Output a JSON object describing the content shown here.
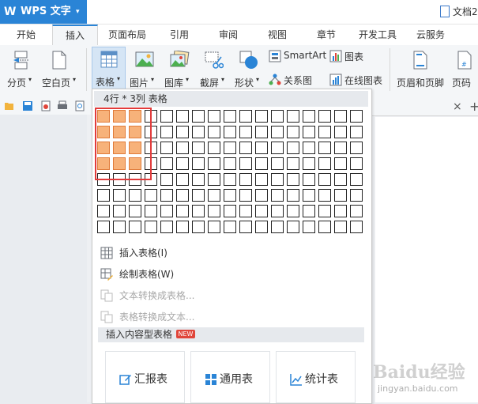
{
  "titlebar": {
    "app_logo": "W",
    "app_name": "WPS 文字",
    "dropdown_arrow": "▾",
    "doc_title": "文档2"
  },
  "menu": {
    "tabs": [
      "开始",
      "插入",
      "页面布局",
      "引用",
      "审阅",
      "视图",
      "章节",
      "开发工具",
      "云服务"
    ],
    "active": "插入"
  },
  "ribbon": {
    "page_break": "分页",
    "blank_page": "空白页",
    "table": "表格",
    "picture": "图片",
    "gallery": "图库",
    "screenshot": "截屏",
    "shape": "形状",
    "smartart": "SmartArt",
    "chart": "图表",
    "relation": "关系图",
    "online_chart": "在线图表",
    "header_footer": "页眉和页脚",
    "page_number": "页码",
    "arrow": "▾"
  },
  "doc_tab": {
    "close": "×",
    "add": "+"
  },
  "dropdown": {
    "header": "4行 * 3列 表格",
    "grid": {
      "rows": 8,
      "cols": 17,
      "selected_rows": 4,
      "selected_cols": 3
    },
    "items": [
      {
        "label": "插入表格(I)",
        "enabled": true,
        "icon": "insert-table-icon"
      },
      {
        "label": "绘制表格(W)",
        "enabled": true,
        "icon": "draw-table-icon"
      },
      {
        "label": "文本转换成表格...",
        "enabled": false,
        "icon": "text-to-table-icon"
      },
      {
        "label": "表格转换成文本...",
        "enabled": false,
        "icon": "table-to-text-icon"
      }
    ],
    "section": "插入内容型表格",
    "new_badge": "NEW",
    "cards": [
      "汇报表",
      "通用表",
      "统计表"
    ]
  },
  "watermark": {
    "text": "Baidu经验",
    "url": "jingyan.baidu.com"
  },
  "colors": {
    "accent": "#2a84d6",
    "selected_cell": "#f7b27a",
    "highlight_box": "#e23b3b"
  }
}
